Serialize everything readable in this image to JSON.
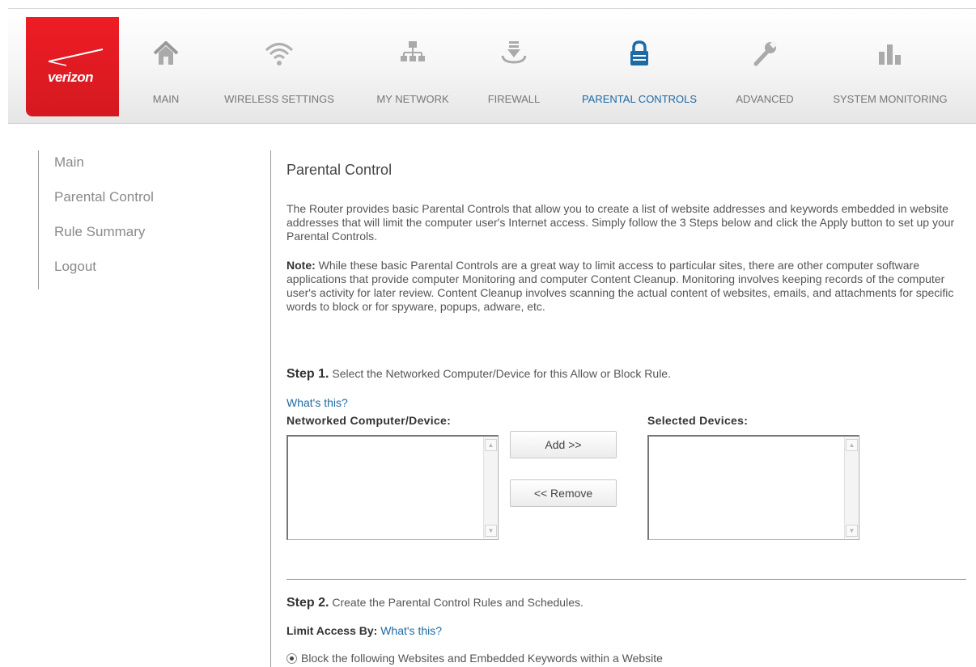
{
  "brand": {
    "logo_text": "verizon",
    "accent_color": "#ee1c25",
    "active_color": "#1d6aa5"
  },
  "nav": {
    "items": [
      {
        "label": "MAIN",
        "icon": "home-icon"
      },
      {
        "label": "WIRELESS SETTINGS",
        "icon": "wifi-icon"
      },
      {
        "label": "MY NETWORK",
        "icon": "network-icon"
      },
      {
        "label": "FIREWALL",
        "icon": "firewall-icon"
      },
      {
        "label": "PARENTAL CONTROLS",
        "icon": "lock-icon",
        "active": true
      },
      {
        "label": "ADVANCED",
        "icon": "wrench-icon"
      },
      {
        "label": "SYSTEM MONITORING",
        "icon": "bar-chart-icon"
      }
    ]
  },
  "sidebar": {
    "items": [
      {
        "label": "Main"
      },
      {
        "label": "Parental Control"
      },
      {
        "label": "Rule Summary"
      },
      {
        "label": "Logout"
      }
    ]
  },
  "content": {
    "title": "Parental Control",
    "intro": "The Router provides basic Parental Controls that allow you to create a list of website addresses and keywords embedded in website addresses that will limit the computer user's Internet access. Simply follow the 3 Steps below and click the Apply button to set up your Parental Controls.",
    "note_label": "Note:",
    "note_text": " While these basic Parental Controls are a great way to limit access to particular sites, there are other computer software applications that provide computer Monitoring and computer Content Cleanup. Monitoring involves keeping records of the computer user's activity for later review. Content Cleanup involves scanning the actual content of websites, emails, and attachments for specific words to block or for spyware, popups, adware, etc.",
    "step1": {
      "label": "Step 1.",
      "text": " Select the Networked Computer/Device for this Allow or Block Rule.",
      "whats_this": "What's this?",
      "left_list_label": "Networked Computer/Device:",
      "right_list_label": "Selected Devices:",
      "add_button": "Add >>",
      "remove_button": "<< Remove"
    },
    "step2": {
      "label": "Step 2.",
      "text": " Create the Parental Control Rules and Schedules.",
      "limit_label": "Limit Access By:",
      "whats_this": "What's this?",
      "radio_option": "Block the following Websites and Embedded Keywords within a Website"
    }
  }
}
